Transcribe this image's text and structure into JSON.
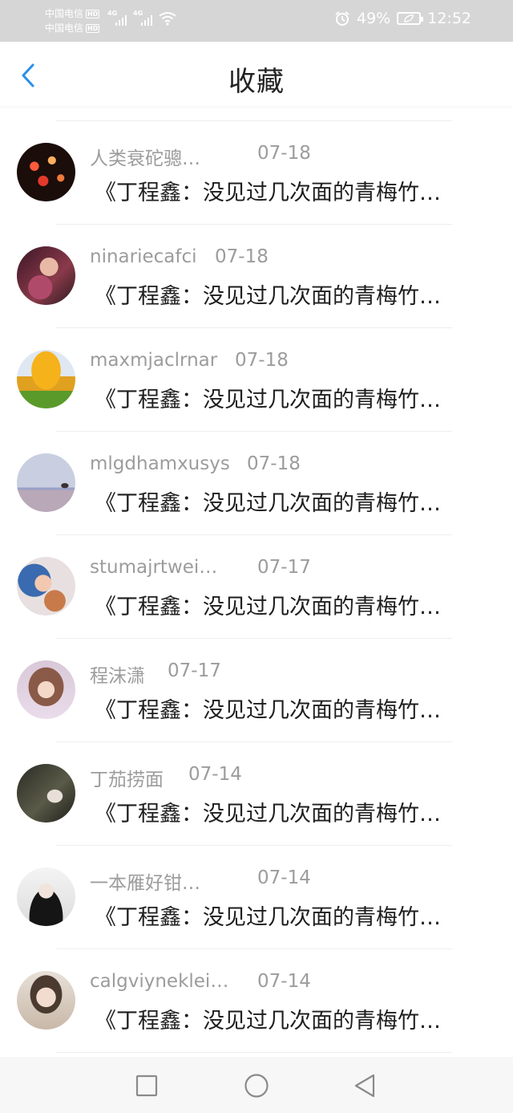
{
  "status_bar": {
    "carrier_1": "中国电信",
    "carrier_2": "中国电信",
    "hd_badge": "HD",
    "network_1": "4G",
    "network_2": "4G",
    "battery_percent": "49%",
    "time": "12:52"
  },
  "header": {
    "title": "收藏"
  },
  "favorites": [
    {
      "name": "人类衰砣骢…",
      "date": "07-18",
      "title": "《丁程鑫：没见过几次面的青梅竹…"
    },
    {
      "name": "ninariecafci",
      "date": "07-18",
      "title": "《丁程鑫：没见过几次面的青梅竹…"
    },
    {
      "name": "maxmjaclrnar",
      "date": "07-18",
      "title": "《丁程鑫：没见过几次面的青梅竹…"
    },
    {
      "name": "mlgdhamxusys",
      "date": "07-18",
      "title": "《丁程鑫：没见过几次面的青梅竹…"
    },
    {
      "name": "stumajrtwei…",
      "date": "07-17",
      "title": "《丁程鑫：没见过几次面的青梅竹…"
    },
    {
      "name": "程沫潇",
      "date": "07-17",
      "title": "《丁程鑫：没见过几次面的青梅竹…"
    },
    {
      "name": "丁茄捞面",
      "date": "07-14",
      "title": "《丁程鑫：没见过几次面的青梅竹…"
    },
    {
      "name": "一本雁好钳…",
      "date": "07-14",
      "title": "《丁程鑫：没见过几次面的青梅竹…"
    },
    {
      "name": "calgviyneklei…",
      "date": "07-14",
      "title": "《丁程鑫：没见过几次面的青梅竹…"
    }
  ],
  "icons": {
    "back": "chevron-left-icon",
    "nav_recent": "square-icon",
    "nav_home": "circle-icon",
    "nav_back": "triangle-back-icon"
  },
  "colors": {
    "accent": "#2b8ee8",
    "status_bar_bg": "#d6d6d6",
    "meta_text": "#9c9c9c",
    "title_text": "#1e1e1e"
  }
}
